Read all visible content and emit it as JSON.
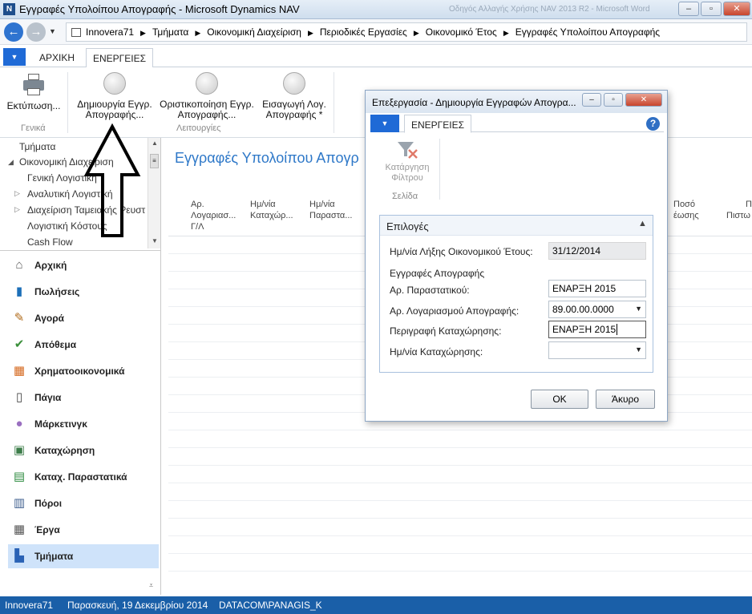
{
  "window": {
    "title": "Εγγραφές Υπολοίπου Απογραφής - Microsoft Dynamics NAV",
    "ghost_title": "Οδηγός Αλλαγής Χρήσης NAV 2013 R2 - Microsoft Word"
  },
  "breadcrumbs": [
    "Innovera71",
    "Τμήματα",
    "Οικονομική Διαχείριση",
    "Περιοδικές Εργασίες",
    "Οικονομικό Έτος",
    "Εγγραφές Υπολοίπου Απογραφής"
  ],
  "ribbon": {
    "tabs": [
      "ΑΡΧΙΚΗ",
      "ΕΝΕΡΓΕΙΕΣ"
    ],
    "active_tab": "ΕΝΕΡΓΕΙΕΣ",
    "print_label": "Εκτύπωση...",
    "group_general": "Γενικά",
    "btn_create_line1": "Δημιουργία Εγγρ.",
    "btn_create_line2": "Απογραφής...",
    "btn_finalize_line1": "Οριστικοποίηση Εγγρ.",
    "btn_finalize_line2": "Απογραφής...",
    "btn_import_line1": "Εισαγωγή Λογ.",
    "btn_import_line2": "Απογραφής *",
    "group_functions": "Λειτουργίες"
  },
  "nav_tree": [
    "Τμήματα",
    "Οικονομική Διαχείριση",
    "Γενική Λογιστική",
    "Αναλυτική Λογιστική",
    "Διαχείριση Ταμειακής Ρευστ",
    "Λογιστική Κόστους",
    "Cash Flow"
  ],
  "nav_menu": [
    {
      "label": "Αρχική",
      "icon": "home-icon",
      "glyph": "⌂"
    },
    {
      "label": "Πωλήσεις",
      "icon": "sales-icon",
      "glyph": "▮"
    },
    {
      "label": "Αγορά",
      "icon": "purchase-icon",
      "glyph": "✎"
    },
    {
      "label": "Απόθεμα",
      "icon": "inventory-icon",
      "glyph": "✔"
    },
    {
      "label": "Χρηματοοικονομικά",
      "icon": "finance-icon",
      "glyph": "▦"
    },
    {
      "label": "Πάγια",
      "icon": "fixed-assets-icon",
      "glyph": "▯"
    },
    {
      "label": "Μάρκετινγκ",
      "icon": "marketing-icon",
      "glyph": "●"
    },
    {
      "label": "Καταχώρηση",
      "icon": "posting-icon",
      "glyph": "▣"
    },
    {
      "label": "Καταχ. Παραστατικά",
      "icon": "posted-documents-icon",
      "glyph": "▤"
    },
    {
      "label": "Πόροι",
      "icon": "resources-icon",
      "glyph": "▥"
    },
    {
      "label": "Έργα",
      "icon": "jobs-icon",
      "glyph": "▦"
    },
    {
      "label": "Τμήματα",
      "icon": "departments-icon",
      "glyph": "▙"
    }
  ],
  "main": {
    "page_title": "Εγγραφές Υπολοίπου Απογρ",
    "columns": [
      {
        "l1": "Αρ.",
        "l2": "Λογαριασ...",
        "l3": "Γ/Λ"
      },
      {
        "l1": "Ημ/νία",
        "l2": "Καταχώρ...",
        "l3": ""
      },
      {
        "l1": "Ημ/νία",
        "l2": "Παραστα...",
        "l3": ""
      },
      {
        "l1": "Ποσό",
        "l2": "έωσης",
        "l3": ""
      },
      {
        "l1": "Π",
        "l2": "Πιστω",
        "l3": ""
      }
    ]
  },
  "dialog": {
    "title": "Επεξεργασία - Δημιουργία Εγγραφών Απογρα...",
    "tab": "ΕΝΕΡΓΕΙΕΣ",
    "filter_line1": "Κατάργηση",
    "filter_line2": "Φίλτρου",
    "group_page": "Σελίδα",
    "panel_title": "Επιλογές",
    "fiscal_end_label": "Ημ/νία Λήξης Οικονομικού Έτους:",
    "fiscal_end_value": "31/12/2014",
    "section_label": "Εγγραφές Απογραφής",
    "doc_no_label": "Αρ. Παραστατικού:",
    "doc_no_value": "ΕΝΑΡΞΗ 2015",
    "account_label": "Αρ. Λογαριασμού Απογραφής:",
    "account_value": "89.00.00.0000",
    "desc_label": "Περιγραφή Καταχώρησης:",
    "desc_value": "ΕΝΑΡΞΗ 2015",
    "posting_date_label": "Ημ/νία Καταχώρησης:",
    "posting_date_value": "",
    "ok": "OK",
    "cancel": "Άκυρο"
  },
  "status": {
    "company": "Innovera71",
    "date": "Παρασκευή, 19 Δεκεμβρίου 2014",
    "user": "DATACOM\\PANAGIS_K"
  },
  "colors": {
    "accent": "#1f6ad6",
    "status_bar": "#1a5fa8",
    "title_blue": "#2e78c8",
    "selected_nav": "#cfe3fa"
  }
}
